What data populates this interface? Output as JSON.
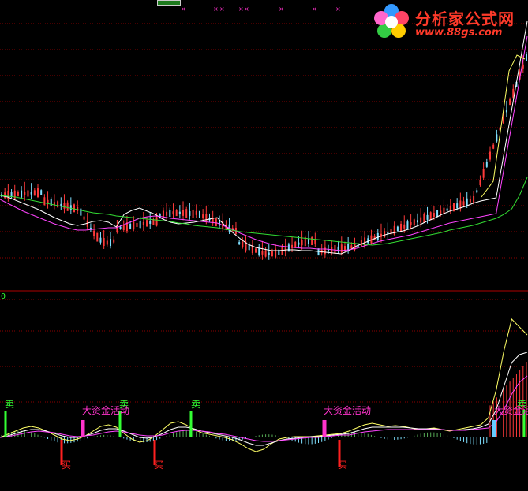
{
  "logo": {
    "title": "分析家公式网",
    "url": "www.88gs.com"
  },
  "lower_panel": {
    "zero_label": "0"
  },
  "signals": {
    "sell_label": "卖",
    "buy_label": "买",
    "capital_label": "大资金活动",
    "capital_label_partial": "大资金活"
  },
  "colors": {
    "background": "#000000",
    "grid": "#8b0000",
    "separator": "#b00000",
    "candle_up": "#ff3a3a",
    "candle_down": "#7fe0ff",
    "ma_white": "#ffffff",
    "ma_yellow": "#ffff66",
    "ma_magenta": "#ff44ff",
    "ma_green": "#33dd33",
    "sell_bar": "#33ff33",
    "buy_bar": "#ff2020",
    "capital_bar": "#ff33cc"
  },
  "chart_data": [
    {
      "type": "candlestick",
      "panel": "price",
      "grid": true,
      "series": [
        {
          "name": "",
          "values": [
            248,
            250,
            254,
            258,
            262,
            266,
            271,
            276,
            280,
            284,
            286,
            284,
            281,
            280,
            282,
            288,
            272,
            267,
            264,
            268,
            272,
            278,
            282,
            284,
            283,
            282,
            280,
            278,
            276,
            286,
            295,
            303,
            310,
            314,
            316,
            318,
            318,
            317,
            317,
            318,
            318,
            319,
            320,
            321,
            322,
            318,
            312,
            308,
            304,
            300,
            297,
            295,
            293,
            290,
            286,
            281,
            277,
            272,
            268,
            265,
            262,
            258,
            255,
            253,
            251,
            250,
            249,
            248,
            247
          ]
        },
        {
          "name": "",
          "values": [
            253,
            258,
            263,
            268,
            272,
            276,
            280,
            284,
            287,
            290,
            292,
            292,
            291,
            290,
            289,
            289,
            285,
            281,
            277,
            275,
            274,
            275,
            277,
            278,
            279,
            280,
            281,
            282,
            283,
            287,
            291,
            296,
            300,
            304,
            307,
            310,
            312,
            313,
            314,
            315,
            315,
            316,
            316,
            317,
            318,
            317,
            315,
            312,
            309,
            306,
            304,
            302,
            300,
            298,
            295,
            292,
            289,
            286,
            283,
            281,
            279,
            277,
            275,
            273,
            271,
            269,
            268,
            267,
            266
          ]
        },
        {
          "name": "",
          "values": [
            248,
            249,
            250,
            252,
            254,
            256,
            258,
            260,
            262,
            264,
            266,
            268,
            270,
            271,
            272,
            274,
            275,
            276,
            277,
            278,
            279,
            280,
            281,
            283,
            284,
            286,
            287,
            288,
            289,
            291,
            292,
            294,
            295,
            296,
            297,
            298,
            299,
            300,
            301,
            302,
            303,
            304,
            305,
            306,
            307,
            308,
            309,
            310,
            311,
            310,
            309,
            307,
            305,
            303,
            301,
            299,
            297,
            295,
            292,
            290,
            288,
            286,
            283,
            280,
            277,
            272,
            265,
            248,
            225
          ]
        }
      ],
      "ylim": [
        0,
        360
      ]
    },
    {
      "type": "line",
      "panel": "indicator",
      "zero_label": "0",
      "series": [
        {
          "name": "",
          "values": [
            0,
            4,
            8,
            12,
            14,
            12,
            8,
            3,
            -2,
            -4,
            -2,
            2,
            8,
            14,
            16,
            13,
            5,
            -2,
            -6,
            -4,
            2,
            10,
            18,
            20,
            16,
            10,
            6,
            4,
            2,
            0,
            -3,
            -8,
            -14,
            -18,
            -15,
            -8,
            -2,
            0,
            1,
            1,
            1,
            2,
            3,
            4,
            5,
            8,
            12,
            16,
            18,
            16,
            14,
            15,
            14,
            12,
            10,
            11,
            12,
            10,
            8,
            10,
            12,
            14,
            16,
            25,
            60,
            110,
            150,
            140,
            130
          ]
        },
        {
          "name": "",
          "values": [
            0,
            2,
            5,
            8,
            10,
            10,
            8,
            5,
            2,
            0,
            0,
            2,
            5,
            9,
            11,
            11,
            8,
            4,
            0,
            -1,
            1,
            5,
            10,
            13,
            13,
            11,
            8,
            6,
            4,
            2,
            0,
            -3,
            -7,
            -10,
            -10,
            -7,
            -4,
            -2,
            -1,
            0,
            1,
            1,
            2,
            3,
            4,
            5,
            8,
            11,
            13,
            13,
            13,
            13,
            13,
            12,
            11,
            11,
            11,
            10,
            9,
            9,
            10,
            11,
            13,
            17,
            35,
            65,
            95,
            105,
            108
          ]
        },
        {
          "name": "",
          "values": [
            0,
            1,
            3,
            5,
            7,
            8,
            7,
            6,
            4,
            2,
            1,
            2,
            3,
            5,
            7,
            8,
            7,
            5,
            3,
            2,
            2,
            3,
            6,
            8,
            9,
            9,
            8,
            7,
            5,
            4,
            2,
            0,
            -2,
            -4,
            -5,
            -5,
            -4,
            -3,
            -2,
            -1,
            0,
            0,
            1,
            2,
            3,
            3,
            5,
            7,
            8,
            9,
            10,
            10,
            10,
            10,
            10,
            10,
            10,
            10,
            9,
            9,
            9,
            10,
            11,
            12,
            20,
            35,
            55,
            70,
            78
          ]
        }
      ],
      "ylim": [
        -40,
        180
      ]
    }
  ]
}
